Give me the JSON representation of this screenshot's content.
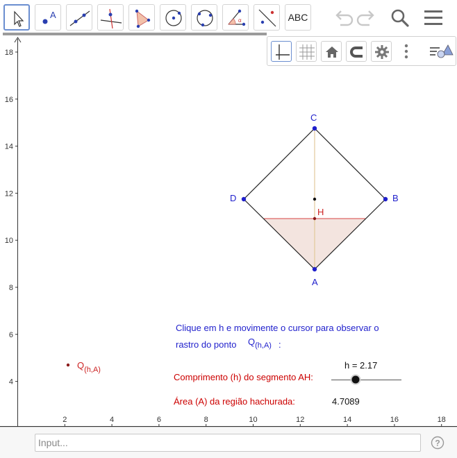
{
  "toolbar": {
    "tools": [
      {
        "name": "move-tool"
      },
      {
        "name": "point-tool",
        "label": "A"
      },
      {
        "name": "line-tool"
      },
      {
        "name": "perpendicular-line-tool"
      },
      {
        "name": "polygon-tool"
      },
      {
        "name": "circle-center-point-tool"
      },
      {
        "name": "circle-three-points-tool"
      },
      {
        "name": "angle-tool",
        "label": "α"
      },
      {
        "name": "reflect-tool"
      },
      {
        "name": "text-tool",
        "label": "ABC"
      }
    ],
    "icons": [
      "undo-icon",
      "redo-icon",
      "search-icon",
      "menu-icon"
    ]
  },
  "graphics_panel": {
    "icons": [
      "axes-icon",
      "grid-icon",
      "home-icon",
      "magnet-icon",
      "gear-icon",
      "more-icon",
      "style-bar-icon"
    ]
  },
  "axes": {
    "x_ticks": [
      "2",
      "4",
      "6",
      "8",
      "10",
      "12",
      "14",
      "16",
      "18"
    ],
    "y_ticks": [
      "4",
      "6",
      "8",
      "10",
      "12",
      "14",
      "16",
      "18"
    ]
  },
  "points": {
    "A": "A",
    "B": "B",
    "C": "C",
    "D": "D",
    "H": "H",
    "Q_main": "Q",
    "Q_sub": "(h,A)"
  },
  "texts": {
    "instruction_line1": "Clique em h e movimente o cursor para observar o",
    "instruction_line2": "rastro do ponto",
    "instruction_q": "Q",
    "instruction_q_sub": "(h,A)",
    "instruction_colon": ":",
    "segment_label": "Comprimento (h) do segmento AH:",
    "area_label": "Área (A) da região hachurada:",
    "area_value": "4.7089"
  },
  "slider": {
    "label": "h = 2.17",
    "value": 2.17
  },
  "input": {
    "placeholder": "Input..."
  },
  "colors": {
    "points": "#1f1fcc",
    "red_text": "#cc0000",
    "instruction_text": "#1f1fcc",
    "hatch_fill": "#f3e4df",
    "segment_yellow": "#e2c99b"
  }
}
